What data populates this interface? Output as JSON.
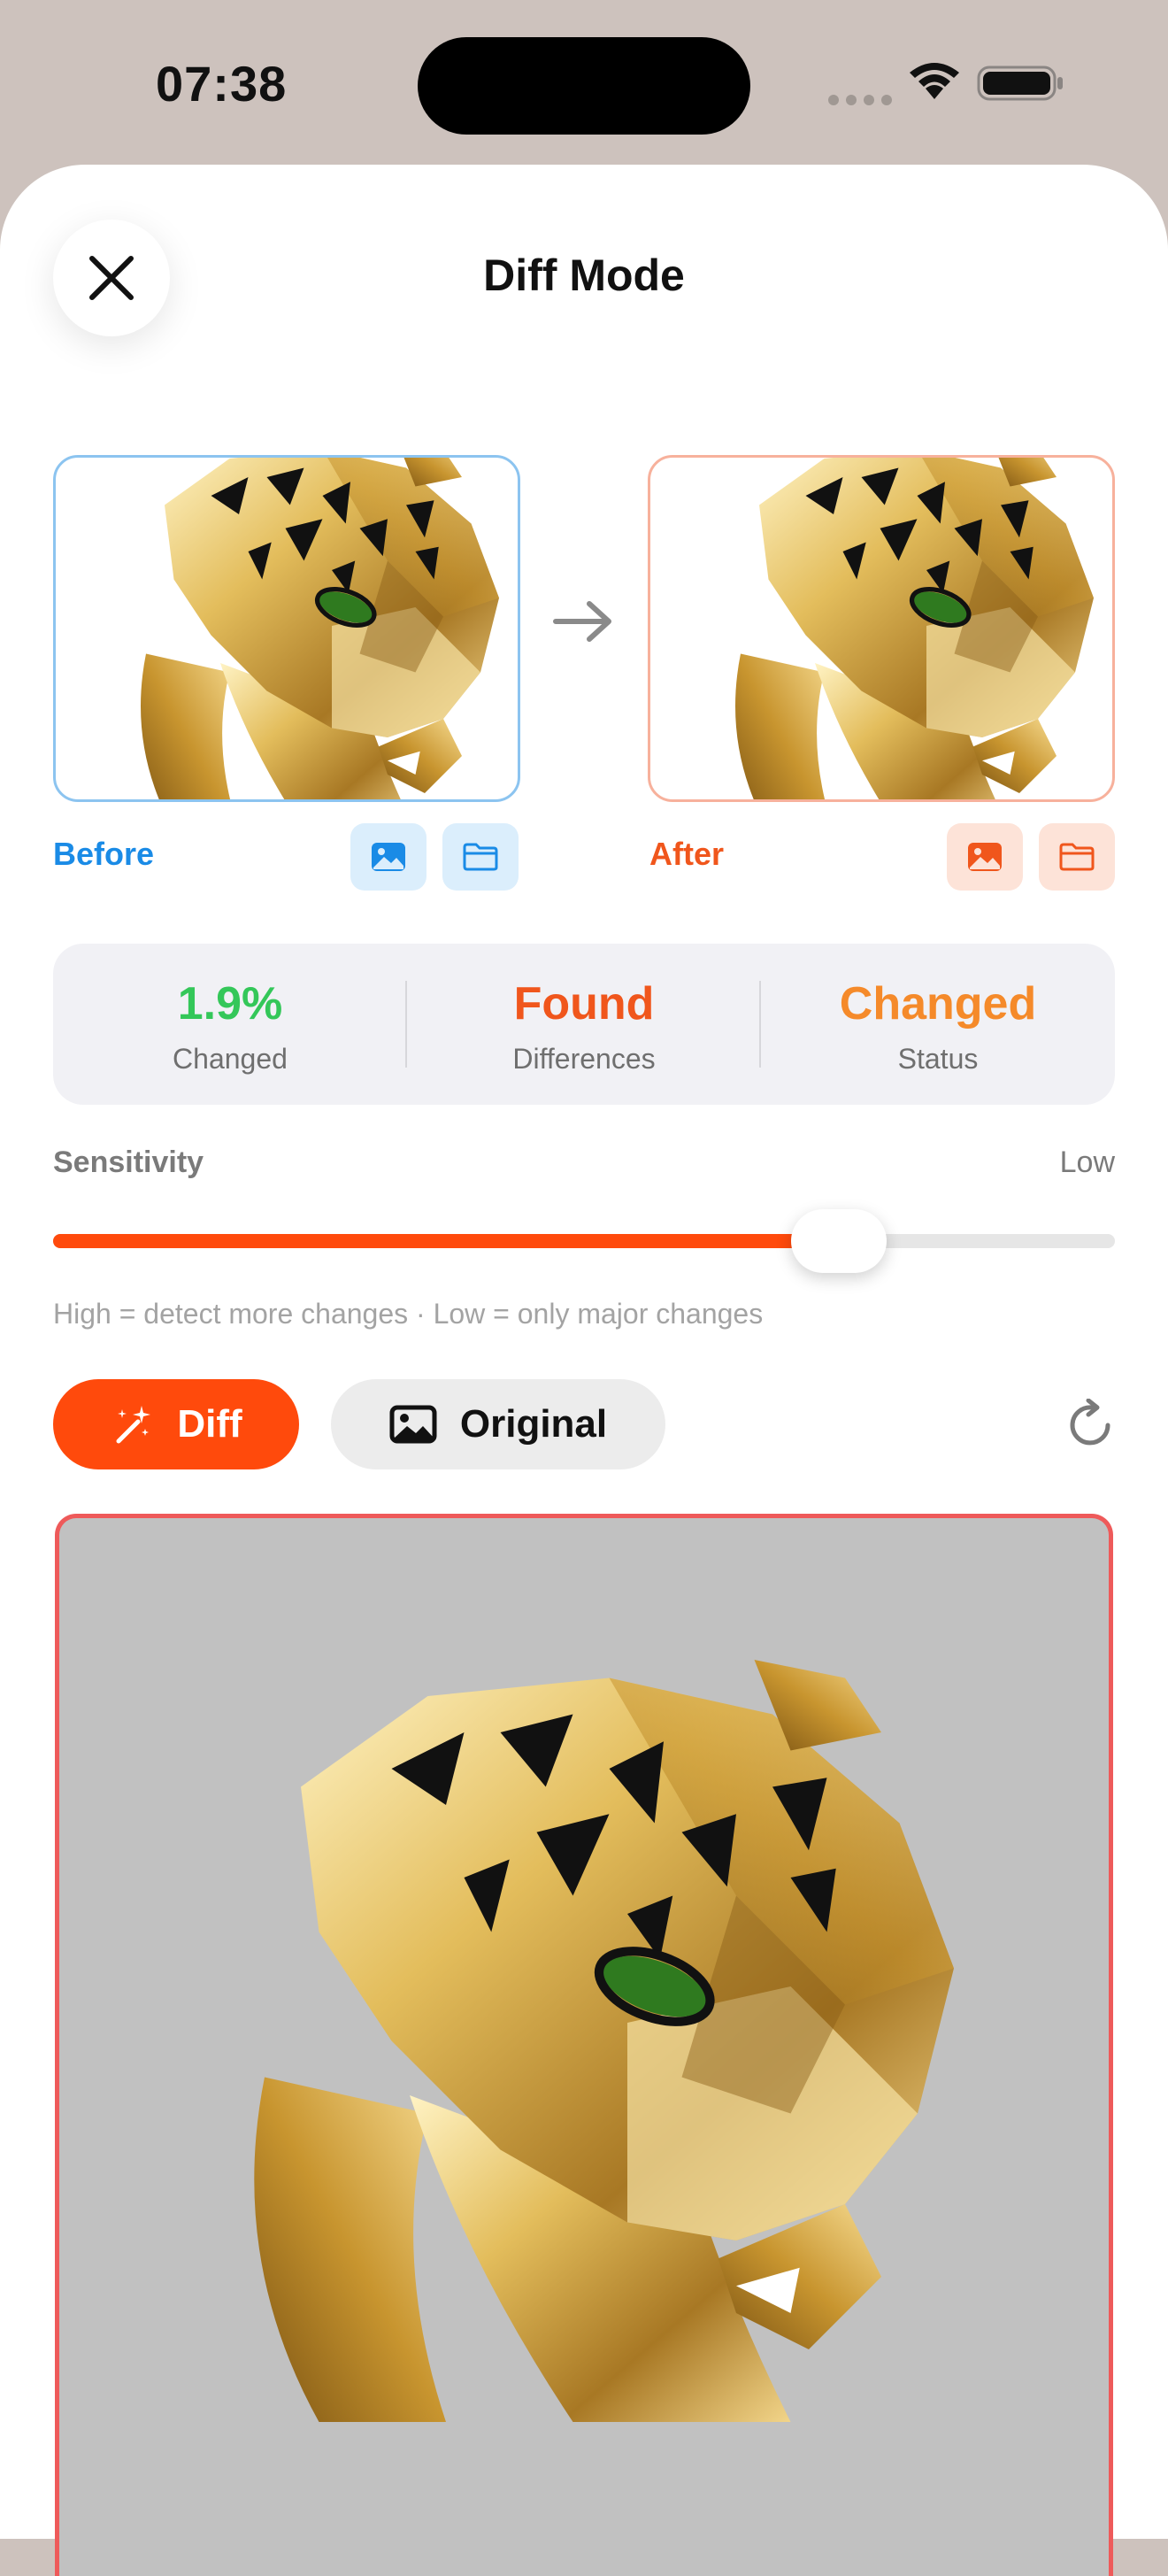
{
  "status_bar": {
    "time": "07:38"
  },
  "header": {
    "title": "Diff Mode"
  },
  "inputs": {
    "before": {
      "label": "Before"
    },
    "after": {
      "label": "After"
    }
  },
  "stats": [
    {
      "value": "1.9%",
      "label": "Changed",
      "color": "#34c759"
    },
    {
      "value": "Found",
      "label": "Differences",
      "color": "#f0561c"
    },
    {
      "value": "Changed",
      "label": "Status",
      "color": "#f58a2a"
    }
  ],
  "sensitivity": {
    "label": "Sensitivity",
    "value_label": "Low",
    "level": 0.74,
    "hint": "High = detect more changes · Low = only major changes"
  },
  "view_modes": {
    "diff": "Diff",
    "original": "Original",
    "selected": "Diff"
  },
  "colors": {
    "accent": "#ff4a0c",
    "before": "#1a8be6",
    "after": "#f0561c"
  }
}
